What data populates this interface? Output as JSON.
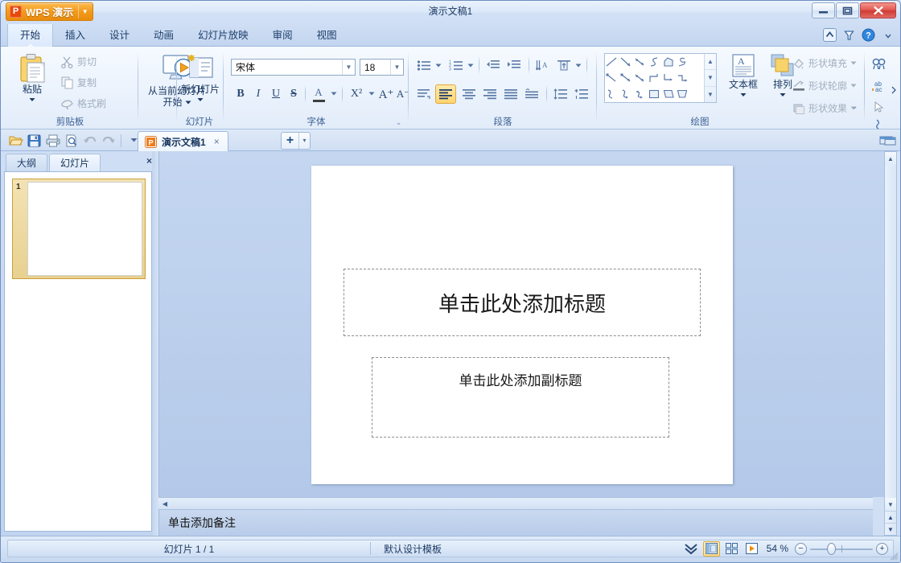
{
  "window": {
    "title": "演示文稿1",
    "app_button": {
      "label": "WPS 演示",
      "badge": "P"
    },
    "controls": {
      "minimize": "minimize-icon",
      "restore": "restore-icon",
      "close": "close-icon"
    }
  },
  "ribbon_tabs": [
    {
      "label": "开始",
      "active": true
    },
    {
      "label": "插入",
      "active": false
    },
    {
      "label": "设计",
      "active": false
    },
    {
      "label": "动画",
      "active": false
    },
    {
      "label": "幻灯片放映",
      "active": false
    },
    {
      "label": "审阅",
      "active": false
    },
    {
      "label": "视图",
      "active": false
    }
  ],
  "tabstrip_right": [
    {
      "name": "collapse-ribbon-icon"
    },
    {
      "name": "help-icon"
    },
    {
      "name": "dropdown-arrow-icon"
    }
  ],
  "groups": {
    "clipboard": {
      "label": "剪贴板",
      "paste": "粘贴",
      "cut": "剪切",
      "copy": "复制",
      "format_painter": "格式刷"
    },
    "slide": {
      "label": "幻灯片",
      "from_current": "从当前幻灯片",
      "from_current_2": "开始",
      "new_slide": "新幻灯片"
    },
    "font": {
      "label": "字体",
      "font_name": "宋体",
      "font_size": "18",
      "bold": "B",
      "italic": "I",
      "underline": "U",
      "strikethrough": "S",
      "font_color": "A",
      "superscript": "X²",
      "grow_font": "A⁺",
      "shrink_font": "A⁻"
    },
    "paragraph": {
      "label": "段落",
      "bullets": "bullets-icon",
      "numbering": "numbering-icon",
      "decrease_indent": "decrease-indent-icon",
      "increase_indent": "increase-indent-icon",
      "text_direction": "text-direction-icon",
      "align_text": "align-text-icon",
      "distribute": "distribute-icon",
      "align_left": "align-left-icon",
      "align_center": "align-center-icon",
      "align_right": "align-right-icon",
      "justify": "justify-icon",
      "distribute_justify": "distribute-justify-icon",
      "line_spacing_up": "line-spacing-increase-icon",
      "line_spacing_down": "line-spacing-decrease-icon",
      "list_level": "list-level-icon"
    },
    "drawing": {
      "label": "绘图",
      "textbox": "文本框",
      "arrange": "排列",
      "shape_fill": "形状填充",
      "shape_outline": "形状轮廓",
      "shape_effects": "形状效果"
    },
    "editing": {
      "find": "find-icon",
      "replace": "replace-icon",
      "select": "select-icon",
      "more": "more-icon"
    }
  },
  "quick_access": [
    {
      "name": "open-icon"
    },
    {
      "name": "save-icon"
    },
    {
      "name": "print-icon"
    },
    {
      "name": "print-preview-icon"
    },
    {
      "name": "undo-icon"
    },
    {
      "name": "redo-icon"
    },
    {
      "name": "customize-qat-icon"
    }
  ],
  "doc_tab": {
    "label": "演示文稿1",
    "close": "×",
    "add": "+",
    "add_arrow": "▾"
  },
  "left_panel": {
    "tabs": [
      {
        "label": "大纲",
        "active": false
      },
      {
        "label": "幻灯片",
        "active": true
      }
    ],
    "close": "×",
    "thumbnails": [
      {
        "number": "1"
      }
    ]
  },
  "slide": {
    "title_placeholder": "单击此处添加标题",
    "subtitle_placeholder": "单击此处添加副标题"
  },
  "notes": {
    "placeholder": "单击添加备注"
  },
  "status_bar": {
    "slide_counter": "幻灯片 1 / 1",
    "template": "默认设计模板",
    "zoom_level": "54 %",
    "view_buttons": [
      {
        "name": "view-chevron-icon",
        "selected": false
      },
      {
        "name": "view-normal-icon",
        "selected": true
      },
      {
        "name": "view-sorter-icon",
        "selected": false
      },
      {
        "name": "view-slideshow-icon",
        "selected": false
      }
    ],
    "zoom_out": "−",
    "zoom_in": "+"
  },
  "colors": {
    "accent_orange": "#ef8c0c",
    "title_text": "#1c3a63",
    "ribbon_bg": "#eaf2fc",
    "panel_bg": "#c8d9f1",
    "selection_gold": "#e0a93a"
  }
}
